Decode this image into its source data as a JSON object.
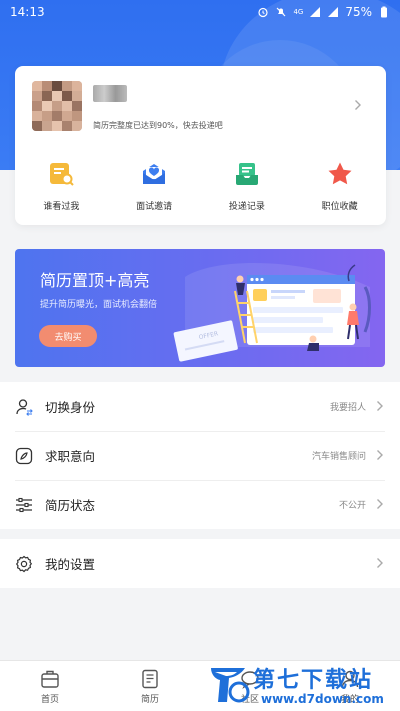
{
  "status_bar": {
    "time": "14:13",
    "battery": "75%",
    "network": "4G"
  },
  "profile": {
    "completion_text": "简历完整度已达到90%，快去投递吧"
  },
  "quick_actions": [
    {
      "label": "谁看过我",
      "icon": "viewer-icon"
    },
    {
      "label": "面试邀请",
      "icon": "invite-mail-icon"
    },
    {
      "label": "投递记录",
      "icon": "delivery-record-icon"
    },
    {
      "label": "职位收藏",
      "icon": "star-icon"
    }
  ],
  "banner": {
    "title": "简历置顶+高亮",
    "subtitle": "提升简历曝光，面试机会翻倍",
    "button": "去购买",
    "illustration_text": "OFFER"
  },
  "menu": [
    {
      "label": "切换身份",
      "value": "我要招人",
      "icon": "switch-identity-icon"
    },
    {
      "label": "求职意向",
      "value": "汽车销售顾问",
      "icon": "compass-icon"
    },
    {
      "label": "简历状态",
      "value": "不公开",
      "icon": "sliders-icon"
    }
  ],
  "settings": {
    "label": "我的设置",
    "icon": "gear-icon"
  },
  "tabs": [
    {
      "label": "首页",
      "icon": "home-icon"
    },
    {
      "label": "简历",
      "icon": "resume-icon"
    },
    {
      "label": "社区",
      "icon": "community-icon"
    },
    {
      "label": "我的",
      "icon": "profile-icon"
    }
  ],
  "watermark": {
    "title": "第七下载站",
    "url": "www.d7down.com"
  },
  "colors": {
    "primary": "#2f6ff0",
    "accent": "#f28c70",
    "banner_end": "#8466f0"
  }
}
